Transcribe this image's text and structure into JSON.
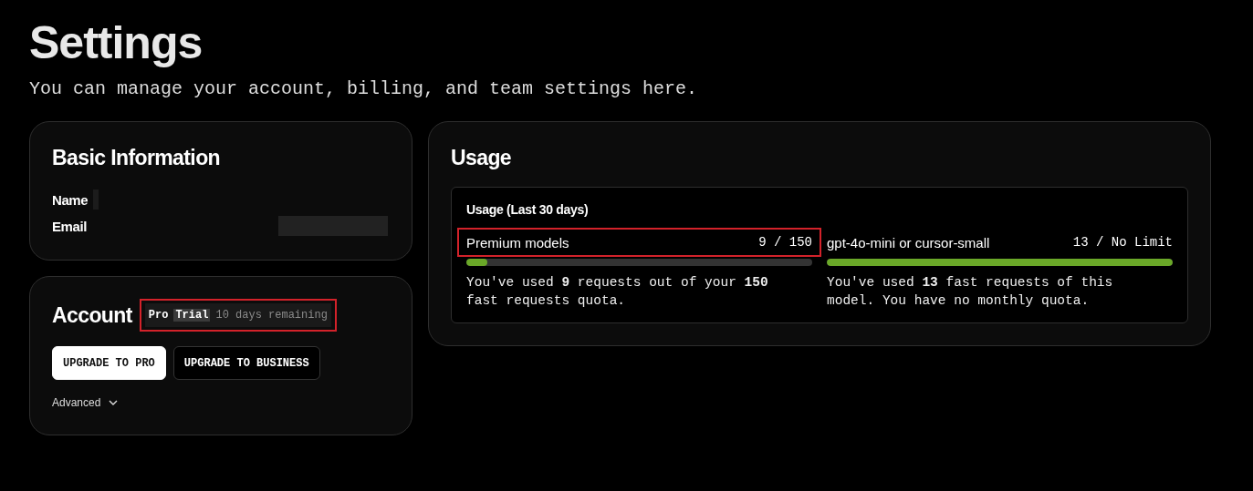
{
  "page": {
    "title": "Settings",
    "subtitle": "You can manage your account, billing, and team settings here."
  },
  "basic_information": {
    "title": "Basic Information",
    "fields": [
      {
        "label": "Name",
        "redacted": true
      },
      {
        "label": "Email",
        "redacted": true
      }
    ]
  },
  "account": {
    "title": "Account",
    "plan_badge": {
      "highlighted": true,
      "segments": [
        {
          "kind": "plan",
          "text": "Pro"
        },
        {
          "kind": "tag",
          "text": "Trial"
        },
        {
          "kind": "note",
          "text": "10 days remaining"
        }
      ]
    },
    "buttons": [
      {
        "label": "UPGRADE TO PRO",
        "primary": true
      },
      {
        "label": "UPGRADE TO BUSINESS",
        "primary": false
      }
    ],
    "advanced": {
      "label": "Advanced",
      "expanded": false
    }
  },
  "usage": {
    "title": "Usage",
    "panel_title": "Usage (Last 30 days)",
    "items": [
      {
        "name": "Premium models",
        "count": "9 / 150",
        "level": 0.06,
        "highlighted": true,
        "description": "You've used **9** requests out of your **150** fast requests quota."
      },
      {
        "name": "gpt-4o-mini or cursor-small",
        "count": "13 / No Limit",
        "level": 1,
        "highlighted": false,
        "description": "You've used **13** fast requests of this model. You have no monthly quota."
      }
    ]
  }
}
